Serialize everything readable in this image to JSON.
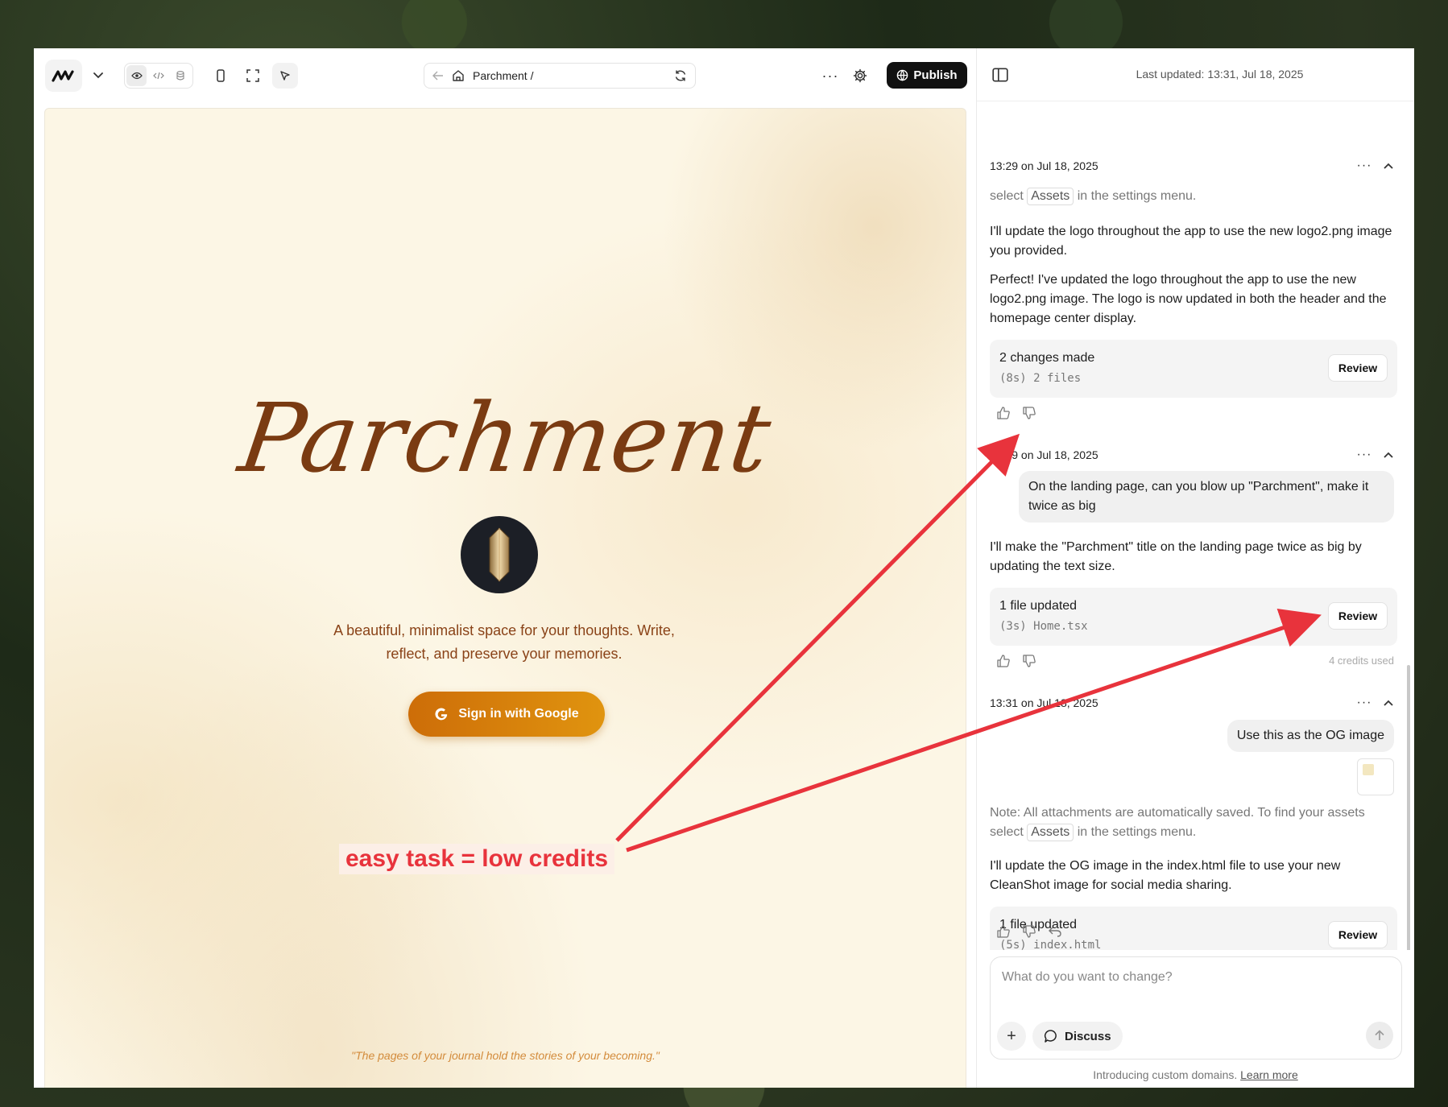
{
  "toolbar": {
    "url_text": "Parchment /",
    "publish_label": "Publish",
    "more_label": "···"
  },
  "preview": {
    "title": "Parchment",
    "tagline": "A beautiful, minimalist space for your thoughts. Write, reflect, and preserve your memories.",
    "signin_label": "Sign in with Google",
    "quote": "\"The pages of your journal hold the stories of your becoming.\""
  },
  "chat": {
    "last_updated": "Last updated: 13:31, Jul 18, 2025",
    "groups": [
      {
        "timestamp": "13:29 on Jul 18, 2025",
        "note_prefix": "select",
        "note_chip": "Assets",
        "note_suffix": "in the settings menu.",
        "assistant_1": "I'll update the logo throughout the app to use the new logo2.png image you provided.",
        "assistant_2": "Perfect! I've updated the logo throughout the app to use the new logo2.png image. The logo is now updated in both the header and the homepage center display.",
        "card_title": "2 changes made",
        "card_sub": "(8s) 2 files",
        "review_label": "Review"
      },
      {
        "timestamp": "13:29 on Jul 18, 2025",
        "user_message": "On the landing page, can you blow up \"Parchment\", make it twice as big",
        "assistant_1": "I'll make the \"Parchment\" title on the landing page twice as big by updating the text size.",
        "card_title": "1 file updated",
        "card_sub": "(3s) Home.tsx",
        "review_label": "Review",
        "credits": "4 credits used"
      },
      {
        "timestamp": "13:31 on Jul 18, 2025",
        "user_message": "Use this as the OG image",
        "note_line1": "Note: All attachments are automatically saved. To find your assets",
        "note_prefix": "select",
        "note_chip": "Assets",
        "note_suffix": "in the settings menu.",
        "assistant_1": "I'll update the OG image in the index.html file to use your new CleanShot image for social media sharing.",
        "card_title": "1 file updated",
        "card_sub": "(5s) index.html",
        "review_label": "Review"
      }
    ],
    "composer": {
      "placeholder": "What do you want to change?",
      "plus_label": "+",
      "discuss_label": "Discuss"
    },
    "footer_text": "Introducing custom domains.",
    "footer_link": "Learn more"
  },
  "annotation": {
    "label": "easy task = low credits",
    "color": "#e8333c"
  },
  "colors": {
    "accent_title": "#7a3b12",
    "signin_gradient_start": "#cd6d08",
    "signin_gradient_end": "#e0940f",
    "publish_bg": "#111111"
  }
}
